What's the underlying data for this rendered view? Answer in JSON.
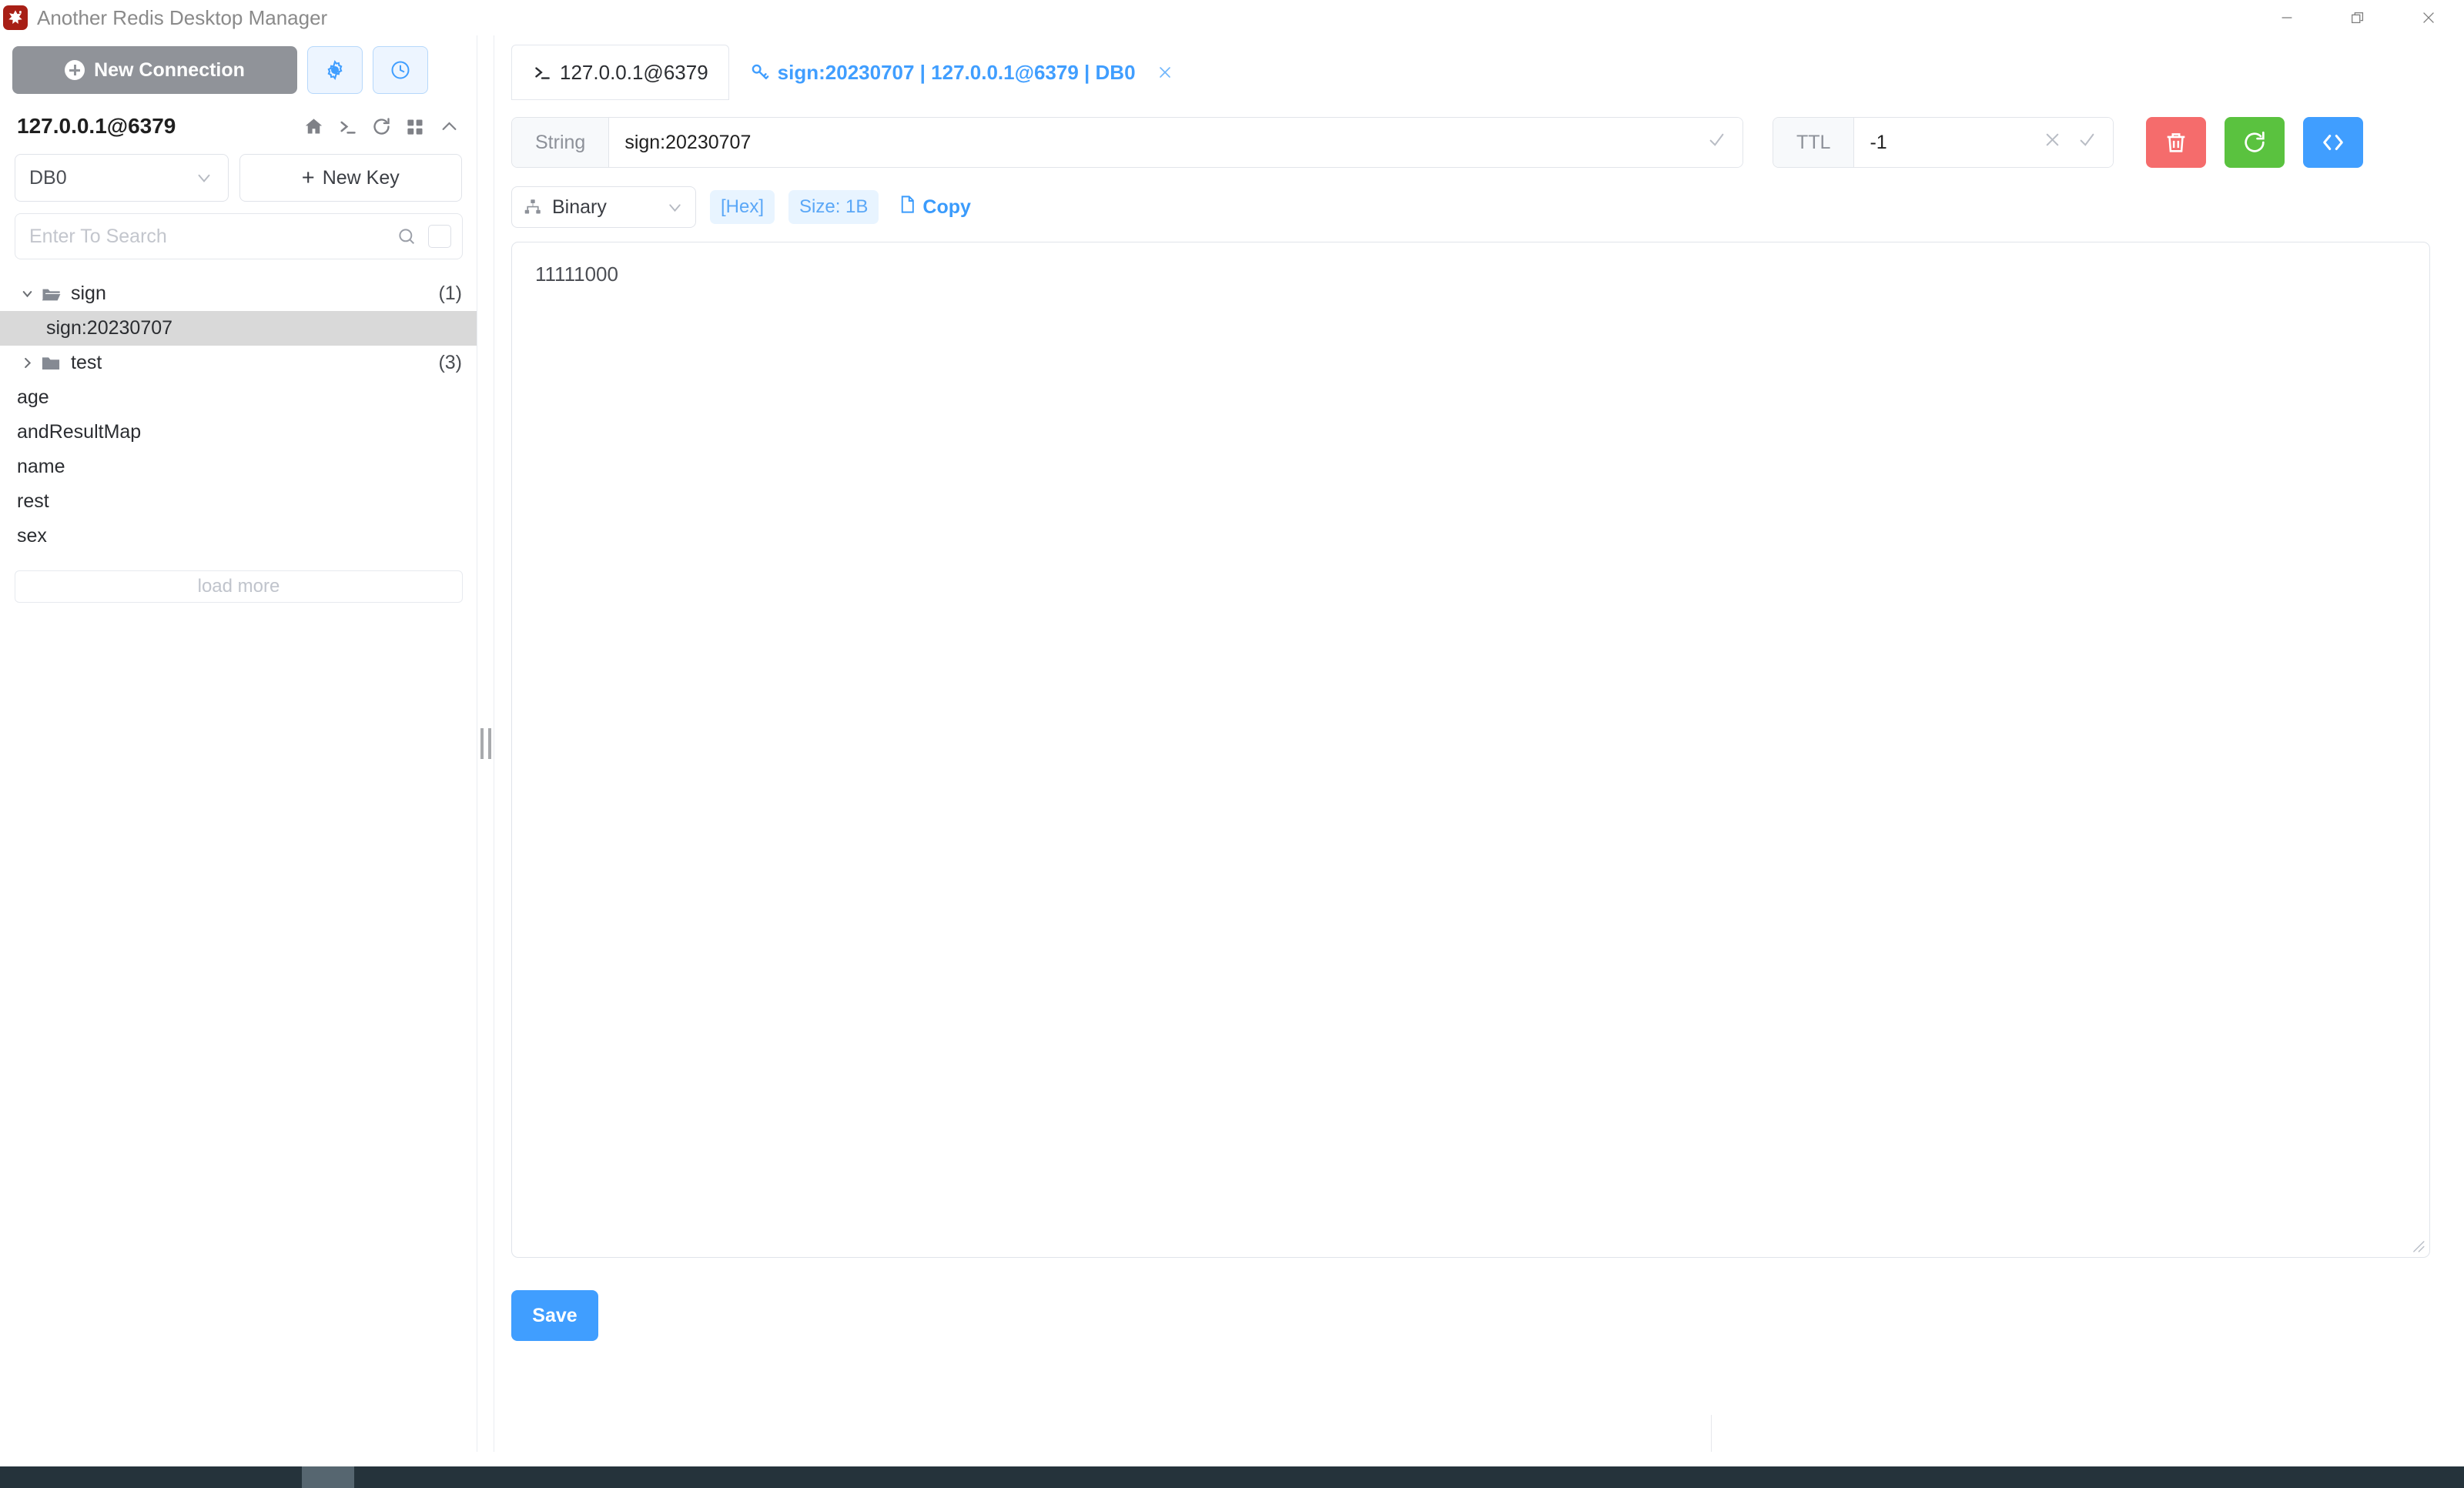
{
  "window": {
    "app_title": "Another Redis Desktop Manager",
    "app_icon": "redis-star-icon",
    "controls": {
      "minimize": "minimize-icon",
      "maximize": "restore-icon",
      "close": "close-icon"
    }
  },
  "sidebar": {
    "new_connection_label": "New Connection",
    "settings_icon": "gear-icon",
    "history_icon": "clock-icon",
    "connection": {
      "name": "127.0.0.1@6379",
      "icons": [
        "home-icon",
        "terminal-icon",
        "refresh-icon",
        "grid-icon",
        "chevron-up-icon"
      ]
    },
    "db_select": {
      "value": "DB0"
    },
    "new_key_label": "New Key",
    "search": {
      "placeholder": "Enter To Search"
    },
    "tree": [
      {
        "type": "folder",
        "label": "sign",
        "count": "(1)",
        "expanded": true
      },
      {
        "type": "key",
        "label": "sign:20230707",
        "selected": true
      },
      {
        "type": "folder",
        "label": "test",
        "count": "(3)",
        "expanded": false
      },
      {
        "type": "key",
        "label": "age",
        "selected": false
      },
      {
        "type": "key",
        "label": "andResultMap",
        "selected": false
      },
      {
        "type": "key",
        "label": "name",
        "selected": false
      },
      {
        "type": "key",
        "label": "rest",
        "selected": false
      },
      {
        "type": "key",
        "label": "sex",
        "selected": false
      }
    ],
    "load_more_label": "load more"
  },
  "tabs": [
    {
      "label": "127.0.0.1@6379",
      "icon": "terminal-icon",
      "active": false,
      "closable": false
    },
    {
      "label": "sign:20230707 | 127.0.0.1@6379 | DB0",
      "icon": "key-icon",
      "active": true,
      "closable": true
    }
  ],
  "key_editor": {
    "type_label": "String",
    "key_name": "sign:20230707",
    "key_confirm_icon": "check-icon",
    "ttl_label": "TTL",
    "ttl_value": "-1",
    "ttl_clear_icon": "close-icon",
    "ttl_confirm_icon": "check-icon",
    "actions": [
      {
        "name": "delete-key-button",
        "icon": "trash-icon",
        "color": "#f56c6c"
      },
      {
        "name": "refresh-key-button",
        "icon": "refresh-icon",
        "color": "#5ac23f"
      },
      {
        "name": "code-view-button",
        "icon": "code-icon",
        "color": "#409eff"
      }
    ],
    "format": {
      "icon": "sitemap-icon",
      "value": "Binary",
      "hex_badge": "[Hex]",
      "size_badge": "Size: 1B",
      "copy_label": "Copy",
      "copy_icon": "document-icon"
    },
    "value": "11111000",
    "save_label": "Save"
  },
  "colors": {
    "accent": "#409eff",
    "danger": "#f56c6c",
    "success": "#5ac23f",
    "muted": "#909399",
    "selected_row": "#d9d9d9",
    "badge_bg": "#e8f4ff"
  }
}
